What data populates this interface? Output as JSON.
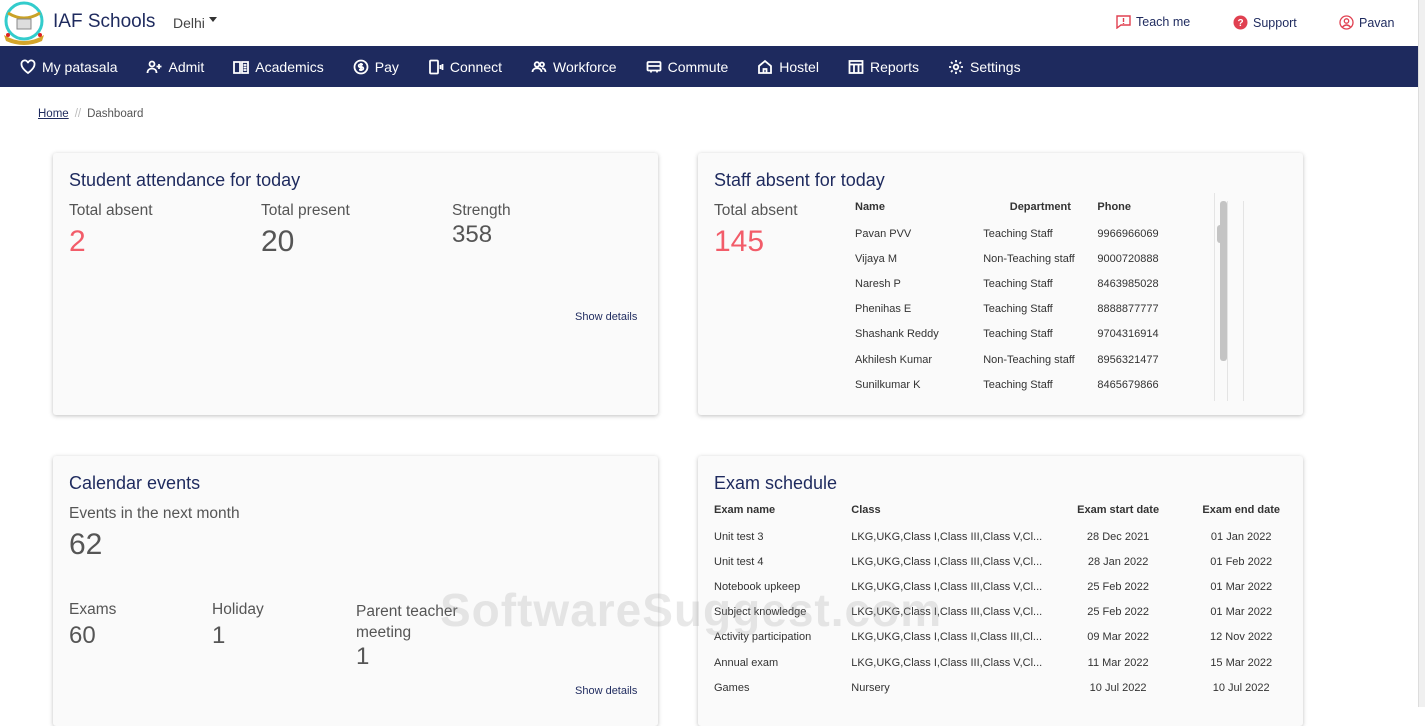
{
  "header": {
    "brand": "IAF Schools",
    "city": "Delhi",
    "teach_me": "Teach me",
    "support": "Support",
    "user": "Pavan"
  },
  "nav": [
    {
      "label": "My patasala",
      "icon": "heart-icon"
    },
    {
      "label": "Admit",
      "icon": "user-plus-icon"
    },
    {
      "label": "Academics",
      "icon": "book-icon"
    },
    {
      "label": "Pay",
      "icon": "dollar-icon"
    },
    {
      "label": "Connect",
      "icon": "phone-icon"
    },
    {
      "label": "Workforce",
      "icon": "users-icon"
    },
    {
      "label": "Commute",
      "icon": "bus-icon"
    },
    {
      "label": "Hostel",
      "icon": "home-icon"
    },
    {
      "label": "Reports",
      "icon": "table-icon"
    },
    {
      "label": "Settings",
      "icon": "gear-icon"
    }
  ],
  "breadcrumb": {
    "home": "Home",
    "current": "Dashboard"
  },
  "attendance": {
    "title": "Student attendance for today",
    "absent_label": "Total absent",
    "absent": "2",
    "present_label": "Total present",
    "present": "20",
    "strength_label": "Strength",
    "strength": "358",
    "show": "Show details"
  },
  "staff": {
    "title": "Staff absent for today",
    "absent_label": "Total absent",
    "absent": "145",
    "headers": [
      "Name",
      "Department",
      "Phone"
    ],
    "rows": [
      [
        "Pavan PVV",
        "Teaching Staff",
        "9966966069"
      ],
      [
        "Vijaya M",
        "Non-Teaching staff",
        "9000720888"
      ],
      [
        "Naresh P",
        "Teaching Staff",
        "8463985028"
      ],
      [
        "Phenihas E",
        "Teaching Staff",
        "8888877777"
      ],
      [
        "Shashank Reddy",
        "Teaching Staff",
        "9704316914"
      ],
      [
        "Akhilesh Kumar",
        "Non-Teaching staff",
        "8956321477"
      ],
      [
        "Sunilkumar K",
        "Teaching Staff",
        "8465679866"
      ]
    ]
  },
  "calendar": {
    "title": "Calendar events",
    "events_label": "Events in the next month",
    "events": "62",
    "exams_label": "Exams",
    "exams": "60",
    "holiday_label": "Holiday",
    "holiday": "1",
    "ptm_label": "Parent teacher meeting",
    "ptm": "1",
    "show": "Show details"
  },
  "exams": {
    "title": "Exam schedule",
    "headers": [
      "Exam name",
      "Class",
      "Exam start date",
      "Exam end date"
    ],
    "rows": [
      [
        "Unit test 3",
        "LKG,UKG,Class I,Class III,Class V,Cl...",
        "28 Dec 2021",
        "01 Jan 2022"
      ],
      [
        "Unit test 4",
        "LKG,UKG,Class I,Class III,Class V,Cl...",
        "28 Jan 2022",
        "01 Feb 2022"
      ],
      [
        "Notebook upkeep",
        "LKG,UKG,Class I,Class III,Class V,Cl...",
        "25 Feb 2022",
        "01 Mar 2022"
      ],
      [
        "Subject knowledge",
        "LKG,UKG,Class I,Class III,Class V,Cl...",
        "25 Feb 2022",
        "01 Mar 2022"
      ],
      [
        "Activity participation",
        "LKG,UKG,Class I,Class II,Class III,Cl...",
        "09 Mar 2022",
        "12 Nov 2022"
      ],
      [
        "Annual exam",
        "LKG,UKG,Class I,Class III,Class V,Cl...",
        "11 Mar 2022",
        "15 Mar 2022"
      ],
      [
        "Games",
        "Nursery",
        "10 Jul 2022",
        "10 Jul 2022"
      ]
    ]
  },
  "watermark": "SoftwareSuggest.com"
}
